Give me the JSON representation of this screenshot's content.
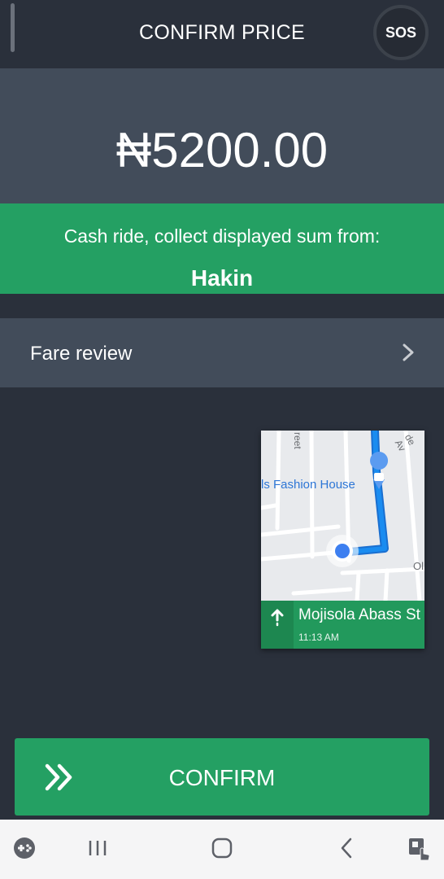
{
  "header": {
    "title": "CONFIRM PRICE",
    "sos_label": "SOS"
  },
  "price": {
    "amount": "₦5200.00"
  },
  "cash_banner": {
    "message": "Cash ride, collect displayed sum from:",
    "rider_name": "Hakin"
  },
  "fare_review": {
    "label": "Fare review"
  },
  "map_card": {
    "poi_label": "ls Fashion House",
    "street_labels": [
      "reet",
      "de Av",
      "Ol"
    ],
    "next_street": "Mojisola Abass St",
    "eta": "11:13 AM"
  },
  "confirm": {
    "label": "CONFIRM"
  },
  "colors": {
    "background": "#2a303b",
    "panel": "#424c5a",
    "accent_green": "#24a063",
    "route_blue": "#1a8cf0",
    "location_blue": "#3d7ff0"
  },
  "icons": {
    "sos": "sos-icon",
    "fare_review": "chevron-right-icon",
    "nav_direction": "arrow-up-icon",
    "confirm": "double-chevron-right-icon",
    "system_nav": [
      "game-launcher-icon",
      "recent-apps-icon",
      "home-icon",
      "back-icon",
      "touch-assist-icon"
    ]
  }
}
